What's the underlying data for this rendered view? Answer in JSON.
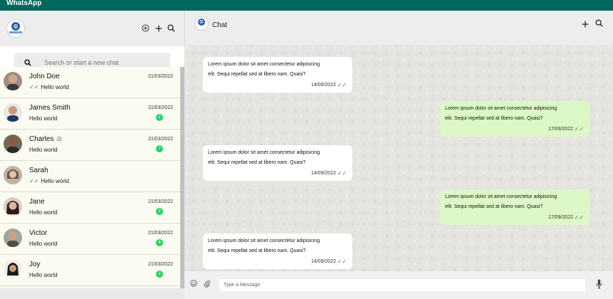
{
  "app": {
    "title": "WhatsApp"
  },
  "search": {
    "placeholder": "Search or start a new chat"
  },
  "chats": [
    {
      "name": "John Doe",
      "message": "Hello world",
      "date": "21/03/2022",
      "ticks": true,
      "unread": ""
    },
    {
      "name": "James Smith",
      "message": "Hello world",
      "date": "21/03/2022",
      "ticks": false,
      "unread": "2"
    },
    {
      "name": "Charles ☺",
      "message": "Hello world",
      "date": "21/03/2022",
      "ticks": false,
      "unread": "7"
    },
    {
      "name": "Sarah",
      "message": "Hello world",
      "date": "",
      "ticks": true,
      "unread": ""
    },
    {
      "name": "Jane",
      "message": "Hello world",
      "date": "21/03/2022",
      "ticks": false,
      "unread": "2"
    },
    {
      "name": "Victor",
      "message": "Hello world",
      "date": "21/03/2022",
      "ticks": false,
      "unread": "6"
    },
    {
      "name": "Joy",
      "message": "Hello world",
      "date": "21/03/2022",
      "ticks": false,
      "unread": "2"
    }
  ],
  "conversation": {
    "title": "Chat",
    "messages": [
      {
        "direction": "in",
        "text": "Lorem ipsum dolor sit amet consectetur adipisicing elit. Sequi repellat sed at libero nam. Quasi?",
        "time": "14/09/2022"
      },
      {
        "direction": "out",
        "text": "Lorem ipsum dolor sit amet consectetur adipisicing elit. Sequi repellat sed at libero nam. Quasi?",
        "time": "17/09/2022"
      },
      {
        "direction": "in",
        "text": "Lorem ipsum dolor sit amet consectetur adipisicing elit. Sequi repellat sed at libero nam. Quasi?",
        "time": "14/09/2022"
      },
      {
        "direction": "out",
        "text": "Lorem ipsum dolor sit amet consectetur adipisicing elit. Sequi repellat sed at libero nam. Quasi?",
        "time": "17/09/2022"
      },
      {
        "direction": "in",
        "text": "Lorem ipsum dolor sit amet consectetur adipisicing elit. Sequi repellat sed at libero nam. Quasi?",
        "time": "14/09/2022"
      }
    ]
  },
  "composer": {
    "placeholder": "Type a Message"
  },
  "colors": {
    "topbar": "#00695c",
    "outgoing": "#dcf8c6",
    "badge": "#25d366"
  },
  "icons": {
    "header": [
      "add-circle-icon",
      "plus-icon",
      "search-icon"
    ],
    "chat_header": [
      "plus-icon",
      "search-icon"
    ],
    "composer": [
      "emoji-icon",
      "attach-icon",
      "microphone-icon"
    ]
  }
}
